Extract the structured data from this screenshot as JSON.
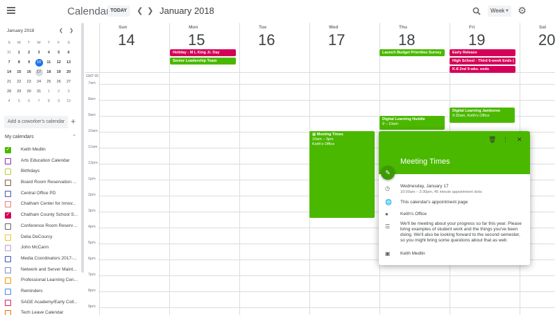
{
  "header": {
    "app_title": "Calendar",
    "today_label": "TODAY",
    "month_label": "January 2018",
    "view_label": "Week"
  },
  "mini_calendar": {
    "month": "January 2018",
    "dow": [
      "S",
      "M",
      "T",
      "W",
      "T",
      "F",
      "S"
    ],
    "weeks": [
      [
        "31",
        "1",
        "2",
        "3",
        "4",
        "5",
        "6"
      ],
      [
        "7",
        "8",
        "9",
        "10",
        "11",
        "12",
        "13"
      ],
      [
        "14",
        "15",
        "16",
        "17",
        "18",
        "19",
        "20"
      ],
      [
        "21",
        "22",
        "23",
        "24",
        "25",
        "26",
        "27"
      ],
      [
        "28",
        "29",
        "30",
        "31",
        "1",
        "2",
        "3"
      ],
      [
        "4",
        "5",
        "6",
        "7",
        "8",
        "9",
        "10"
      ]
    ]
  },
  "sidebar": {
    "coworker_placeholder": "Add a coworker's calendar",
    "my_calendars_label": "My calendars",
    "calendars": [
      {
        "label": "Keith Medlin",
        "color": "#4bb800",
        "checked": true
      },
      {
        "label": "Arts Education Calendar",
        "color": "#8e24aa",
        "checked": false
      },
      {
        "label": "Birthdays",
        "color": "#c0ca33",
        "checked": false
      },
      {
        "label": "Board Room Reservation ...",
        "color": "#795548",
        "checked": false
      },
      {
        "label": "Central Office PD",
        "color": "#3f51b5",
        "checked": false
      },
      {
        "label": "Chatham Center for Innov...",
        "color": "#e67c73",
        "checked": false
      },
      {
        "label": "Chatham County School S...",
        "color": "#d50057",
        "checked": true
      },
      {
        "label": "Conference Room Reservat...",
        "color": "#616161",
        "checked": false
      },
      {
        "label": "Delia DeCourcy",
        "color": "#f6bf26",
        "checked": false
      },
      {
        "label": "John McCann",
        "color": "#b39ddb",
        "checked": false
      },
      {
        "label": "Media Coordinators 2017-...",
        "color": "#3f51b5",
        "checked": false
      },
      {
        "label": "Network and Server Maint...",
        "color": "#7986cb",
        "checked": false
      },
      {
        "label": "Professional Learning Cen...",
        "color": "#f09300",
        "checked": false
      },
      {
        "label": "Reminders",
        "color": "#4285f4",
        "checked": false
      },
      {
        "label": "SAGE Academy/Early Coll...",
        "color": "#d81b60",
        "checked": false
      },
      {
        "label": "Tech Leave Calendar",
        "color": "#ef6c00",
        "checked": false
      }
    ]
  },
  "week": {
    "timezone": "GMT-05",
    "days": [
      {
        "dow": "Sun",
        "date": "14"
      },
      {
        "dow": "Mon",
        "date": "15"
      },
      {
        "dow": "Tue",
        "date": "16"
      },
      {
        "dow": "Wed",
        "date": "17"
      },
      {
        "dow": "Thu",
        "date": "18"
      },
      {
        "dow": "Fri",
        "date": "19"
      },
      {
        "dow": "Sat",
        "date": "20"
      }
    ],
    "hours": [
      "7am",
      "8am",
      "9am",
      "10am",
      "11am",
      "12pm",
      "1pm",
      "2pm",
      "3pm",
      "4pm",
      "5pm",
      "6pm",
      "7pm",
      "8pm",
      "9pm"
    ]
  },
  "all_day_events": {
    "mon_1": "Holiday - M L King Jr. Day",
    "mon_2": "Senior Leadership Team",
    "thu_1": "Launch Budget Priorities Survey",
    "fri_1": "Early Release",
    "fri_2": "High School - Third 6-week Ends (",
    "fri_3": "K-8 2nd 9-wks. ends"
  },
  "events": {
    "wed_title": "Meeting Times",
    "wed_time": "10am – 3pm",
    "wed_loc": "Keith's Office",
    "thu_title": "Digital Learning Huddle",
    "thu_time": "9 – 10am",
    "fri_title": "Digital Learning Jamboree",
    "fri_time": "9:30am, Keith's Office"
  },
  "popup": {
    "title": "Meeting Times",
    "date": "Wednesday, January 17",
    "slots": "10:00am – 3:30pm, 45 minute appointment slots",
    "link": "This calendar's appointment page",
    "location": "Keith's Office",
    "description": "We'll be meeting about your progress so far this year. Please bring examples of student work and the things you've been doing.  We'll also be looking forward to the second semester, so you might bring some questions about that as well.",
    "organizer": "Keith Medlin"
  }
}
